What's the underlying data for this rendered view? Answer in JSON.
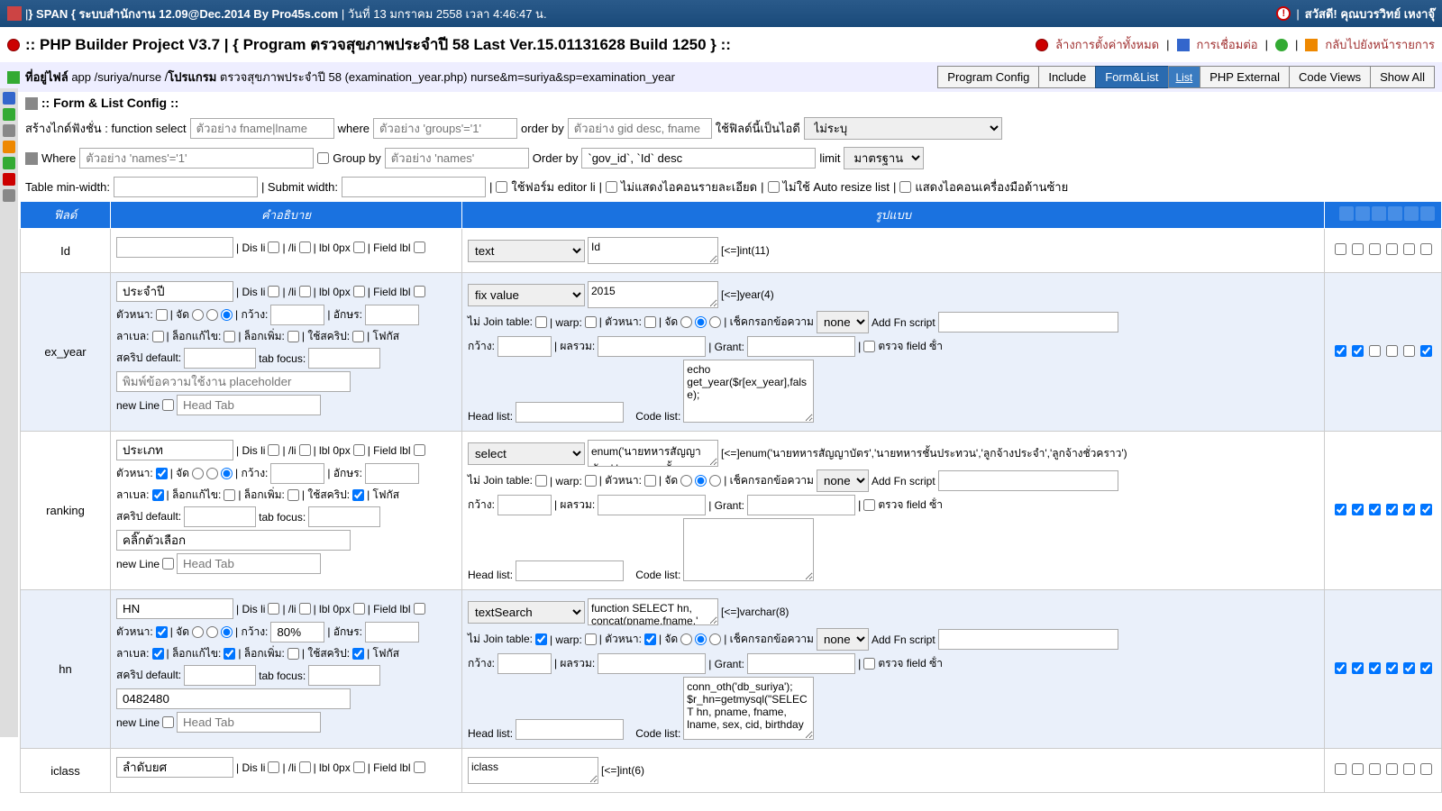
{
  "topbar": {
    "title": "} SPAN { ระบบสํานักงาน 12.09@Dec.2014 By Pro45s.com",
    "date": "วันที่ 13 มกราคม 2558 เวลา 4:46:47 น.",
    "greeting": "สวัสดี! คุณบวรวิทย์ เหงาจุ๊"
  },
  "titlebar": {
    "title": ":: PHP Builder Project V3.7 | { Program ตรวจสุขภาพประจําปี 58 Last Ver.15.01131628 Build 1250 } ::",
    "clear": "ล้างการตั้งค่าทั้งหมด",
    "connect": "การเชื่อมต่อ",
    "back": "กลับไปยังหน้ารายการ"
  },
  "breadcrumb": {
    "label": "ที่อยู่ไฟล์",
    "path1": "app /suriya/nurse /",
    "path2b": "โปรแกรม",
    "path3": " ตรวจสุขภาพประจําปี 58 (examination_year.php) nurse&m=suriya&sp=examination_year"
  },
  "tabs": {
    "program_config": "Program Config",
    "include": "Include",
    "formlist": "Form&List",
    "list": "List",
    "php_external": "PHP External",
    "code_views": "Code Views",
    "show_all": "Show All"
  },
  "section_head": ":: Form & List Config ::",
  "cfg1": {
    "lbl1": "สร้างไกด์ฟังชั่น : function select",
    "ph1": "ตัวอย่าง fname|lname",
    "lbl2": "where",
    "ph2": "ตัวอย่าง 'groups'='1'",
    "lbl3": "order by",
    "ph3": "ตัวอย่าง gid desc, fname",
    "lbl4": "ใช้ฟิลด์นี้เป็นไอดี",
    "sel4": "ไม่ระบุ"
  },
  "cfg2": {
    "lbl1": "Where",
    "ph1": "ตัวอย่าง 'names'='1'",
    "lbl2": "Group by",
    "ph2": "ตัวอย่าง 'names'",
    "lbl3": "Order by",
    "val3": "`gov_id`, `Id` desc",
    "lbl4": "limit",
    "sel4": "มาตรฐาน"
  },
  "cfg3": {
    "lbl1": "Table min-width:",
    "lbl2": "| Submit width:",
    "chk1": "ใช้ฟอร์ม editor li",
    "chk2": "ไม่แสดงไอคอนรายละเอียด",
    "chk3": "ไม่ใช้ Auto resize list",
    "chk4": "แสดงไอคอนเครื่องมือด้านซ้าย"
  },
  "thead": {
    "c1": "ฟิลด์",
    "c2": "คําอธิบาย",
    "c3": "รูปแบบ"
  },
  "rowlabels": {
    "dis_li": "| Dis li",
    "sli": "| /li",
    "lbl0": "| lbl 0px",
    "fieldlbl": "| Field lbl",
    "bold": "ตัวหนา:",
    "align": "| จัด",
    "width": "| กว้าง:",
    "chars": "| อักษร:",
    "label": "ลาเบล:",
    "lockedit": "| ล็อกแก้ไข:",
    "lockadd": "| ล็อกเพิ่ม:",
    "usescript": "| ใช้สคริป:",
    "focus": "| โฟกัส",
    "scriptdef": "สคริป default:",
    "tabfocus": "tab focus:",
    "ph_placeholder": "พิมพ์ข้อความใช้งาน placeholder",
    "newline": "new Line",
    "headtab": "Head Tab",
    "nojoin": "ไม่ Join table:",
    "warp": "| warp:",
    "bold2": "| ตัวหนา:",
    "align2": "| จัด",
    "checkmsg": "| เช็คกรอกข้อความ",
    "none": "none",
    "addfn": "Add Fn script",
    "width2": "กว้าง:",
    "sum": "| ผลรวม:",
    "grant": "| Grant:",
    "checkfield": "ตรวจ field ซ้ํา",
    "headlist": "Head list:",
    "codelist": "Code list:"
  },
  "rows": [
    {
      "field": "Id",
      "desc_name": "",
      "type": "text",
      "sql": "Id",
      "dtype": "[<=]int(11)",
      "opts_simple": true,
      "script": "",
      "chk": [
        false,
        false,
        false,
        false,
        false,
        false
      ]
    },
    {
      "field": "ex_year",
      "desc_name": "ประจําปี",
      "type": "fix value",
      "sql": "2015",
      "dtype": "[<=]year(4)",
      "opts_simple": false,
      "bold": false,
      "label_chk": false,
      "usescript": false,
      "placeholder": "",
      "script": "echo get_year($r[ex_year],false);",
      "chk": [
        true,
        true,
        false,
        false,
        false,
        true
      ]
    },
    {
      "field": "ranking",
      "desc_name": "ประเภท",
      "type": "select",
      "sql": "enum('นายทหารสัญญาบัตร','นายทหารชั้น",
      "dtype": "[<=]enum('นายทหารสัญญาบัตร','นายทหารชั้นประทวน','ลูกจ้างประจํา','ลูกจ้างชั่วคราว')",
      "opts_simple": false,
      "bold": true,
      "label_chk": true,
      "usescript": true,
      "placeholder": "คลิ๊กตัวเลือก",
      "script": "",
      "chk": [
        true,
        true,
        true,
        true,
        true,
        true
      ]
    },
    {
      "field": "hn",
      "desc_name": "HN",
      "type": "textSearch",
      "sql": "function SELECT hn, concat(pname,fname,'",
      "dtype": "[<=]varchar(8)",
      "opts_simple": false,
      "bold": true,
      "label_chk": true,
      "lockedit": true,
      "usescript": true,
      "width": "80%",
      "nojoin": true,
      "bold2": true,
      "placeholder": "0482480",
      "script": "conn_oth('db_suriya'); $r_hn=getmysql(\"SELECT hn, pname, fname, lname, sex, cid, birthday",
      "chk": [
        true,
        true,
        true,
        true,
        true,
        true
      ]
    },
    {
      "field": "iclass",
      "desc_name": "ลําดับยศ",
      "type": "",
      "sql": "iclass",
      "dtype": "[<=]int(6)",
      "opts_simple": true,
      "script": "",
      "chk": [
        false,
        false,
        false,
        false,
        false,
        false
      ]
    }
  ]
}
